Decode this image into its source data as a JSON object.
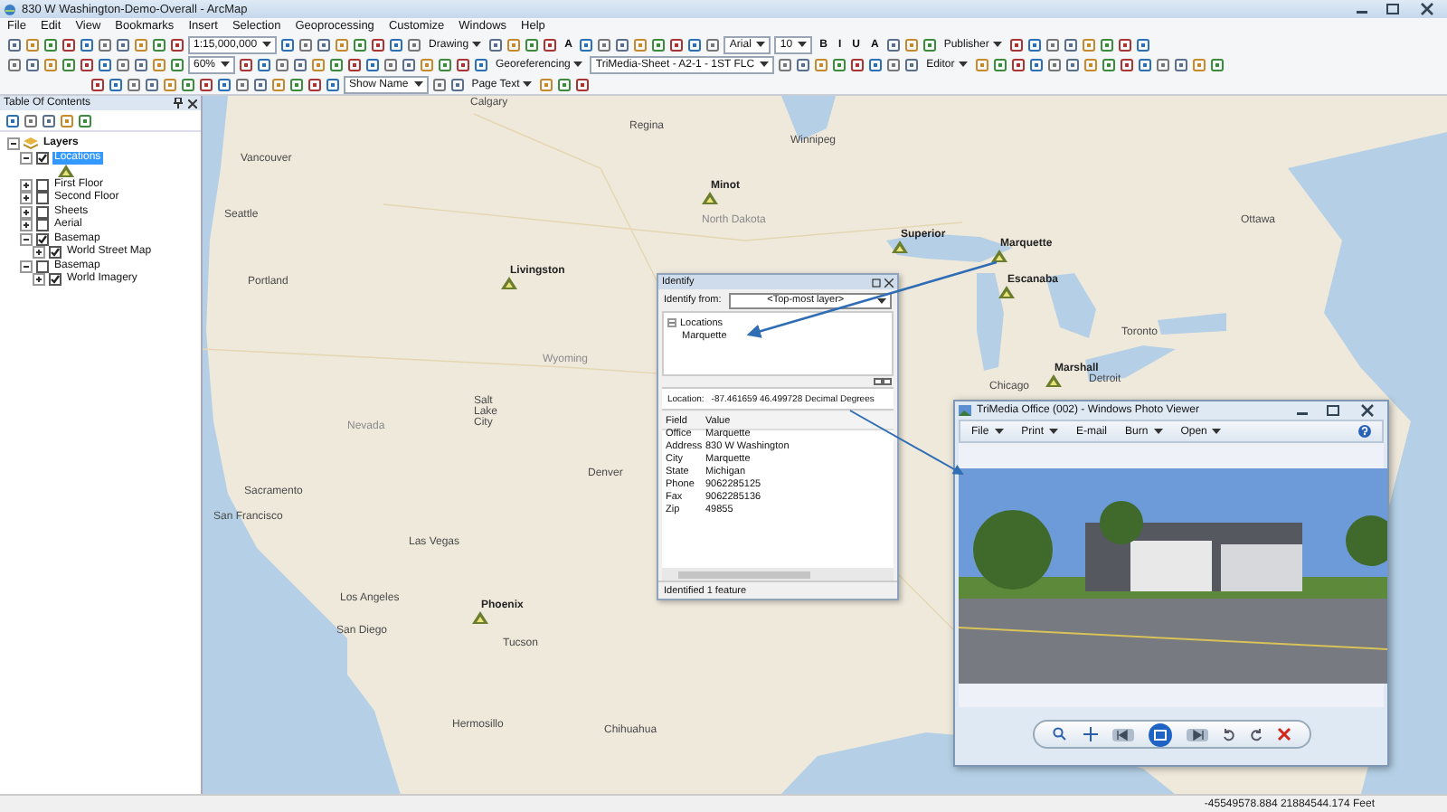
{
  "window": {
    "title": "830 W Washington-Demo-Overall - ArcMap"
  },
  "menu_bar": [
    "File",
    "Edit",
    "View",
    "Bookmarks",
    "Insert",
    "Selection",
    "Geoprocessing",
    "Customize",
    "Windows",
    "Help"
  ],
  "toolbars": [
    {
      "items": [
        {
          "kind": "field",
          "text": "1:15,000,000"
        },
        {
          "kind": "menu",
          "text": "Drawing"
        },
        {
          "kind": "format",
          "text": "A"
        },
        {
          "kind": "field",
          "text": "Arial"
        },
        {
          "kind": "field",
          "text": "10"
        },
        {
          "kind": "format",
          "text": "B"
        },
        {
          "kind": "format",
          "text": "I"
        },
        {
          "kind": "format",
          "text": "U"
        },
        {
          "kind": "format",
          "text": "A"
        },
        {
          "kind": "menu",
          "text": "Publisher"
        }
      ]
    },
    {
      "items": [
        {
          "kind": "field",
          "text": "60%"
        },
        {
          "kind": "menu",
          "text": "Georeferencing"
        },
        {
          "kind": "field",
          "text": "TriMedia-Sheet - A2-1 - 1ST FLC"
        },
        {
          "kind": "menu",
          "text": "Editor"
        }
      ]
    },
    {
      "items": [
        {
          "kind": "field",
          "text": "Show Name"
        },
        {
          "kind": "menu",
          "text": "Page Text"
        }
      ]
    }
  ],
  "table_of_contents": {
    "title": "Table Of Contents",
    "layers": [
      {
        "label": "Layers",
        "kind": "frame",
        "expanded": true,
        "selected": false,
        "children": [
          {
            "label": "Locations",
            "kind": "point-layer",
            "checked": true,
            "expanded": true,
            "selected": true
          },
          {
            "label": "First Floor",
            "checked": false,
            "expanded": false,
            "selected": false
          },
          {
            "label": "Second Floor",
            "checked": false,
            "expanded": false,
            "selected": false
          },
          {
            "label": "Sheets",
            "checked": false,
            "expanded": false,
            "selected": false
          },
          {
            "label": "Aerial",
            "checked": false,
            "expanded": false,
            "selected": false
          },
          {
            "label": "Basemap",
            "checked": true,
            "expanded": true,
            "selected": false,
            "children": [
              {
                "label": "World Street Map",
                "checked": true,
                "expanded": false,
                "selected": false
              }
            ]
          },
          {
            "label": "Basemap",
            "checked": false,
            "expanded": true,
            "selected": false,
            "children": [
              {
                "label": "World Imagery",
                "checked": true,
                "expanded": false,
                "selected": false
              }
            ]
          }
        ]
      }
    ]
  },
  "map": {
    "labels": [
      {
        "text": "Calgary",
        "kind": "city"
      },
      {
        "text": "Regina",
        "kind": "city"
      },
      {
        "text": "Winnipeg",
        "kind": "city"
      },
      {
        "text": "Vancouver",
        "kind": "city"
      },
      {
        "text": "Seattle",
        "kind": "city"
      },
      {
        "text": "Portland",
        "kind": "city"
      },
      {
        "text": "North Dakota",
        "kind": "region"
      },
      {
        "text": "Minot",
        "kind": "site"
      },
      {
        "text": "Superior",
        "kind": "site"
      },
      {
        "text": "Marquette",
        "kind": "site"
      },
      {
        "text": "Escanaba",
        "kind": "site"
      },
      {
        "text": "Livingston",
        "kind": "site"
      },
      {
        "text": "Ottawa",
        "kind": "city"
      },
      {
        "text": "Toronto",
        "kind": "city"
      },
      {
        "text": "Marshall",
        "kind": "site"
      },
      {
        "text": "Detroit",
        "kind": "city"
      },
      {
        "text": "Chicago",
        "kind": "city"
      },
      {
        "text": "Wyoming",
        "kind": "region"
      },
      {
        "text": "Nevada",
        "kind": "region"
      },
      {
        "text": "Salt Lake City",
        "kind": "city"
      },
      {
        "text": "Denver",
        "kind": "city"
      },
      {
        "text": "Sacramento",
        "kind": "city"
      },
      {
        "text": "San Francisco",
        "kind": "city"
      },
      {
        "text": "Las Vegas",
        "kind": "city"
      },
      {
        "text": "Los Angeles",
        "kind": "city"
      },
      {
        "text": "Phoenix",
        "kind": "site"
      },
      {
        "text": "San Diego",
        "kind": "city"
      },
      {
        "text": "Tucson",
        "kind": "city"
      },
      {
        "text": "Hermosillo",
        "kind": "city"
      },
      {
        "text": "Chihuahua",
        "kind": "city"
      }
    ]
  },
  "identify_window": {
    "title": "Identify",
    "from_label": "Identify from:",
    "from_value": "<Top-most layer>",
    "tree": [
      {
        "label": "Locations",
        "expanded": true,
        "children": [
          {
            "label": "Marquette",
            "selected": false
          }
        ]
      }
    ],
    "location_label": "Location:",
    "location_value": "-87.461659  46.499728 Decimal Degrees",
    "columns": [
      "Field",
      "Value"
    ],
    "rows": [
      [
        "Office",
        "Marquette"
      ],
      [
        "Address",
        "830 W Washington"
      ],
      [
        "City",
        "Marquette"
      ],
      [
        "State",
        "Michigan"
      ],
      [
        "Phone",
        "9062285125"
      ],
      [
        "Fax",
        "9062285136"
      ],
      [
        "Zip",
        "49855"
      ]
    ],
    "footer": "Identified 1 feature"
  },
  "photo_viewer": {
    "title": "TriMedia Office (002) - Windows Photo Viewer",
    "menu": [
      {
        "text": "File",
        "dropdown": true
      },
      {
        "text": "Print",
        "dropdown": true
      },
      {
        "text": "E-mail",
        "dropdown": false
      },
      {
        "text": "Burn",
        "dropdown": true
      },
      {
        "text": "Open",
        "dropdown": true
      }
    ]
  },
  "status_bar": {
    "coordinates": "-45549578.884  21884544.174 Feet"
  }
}
